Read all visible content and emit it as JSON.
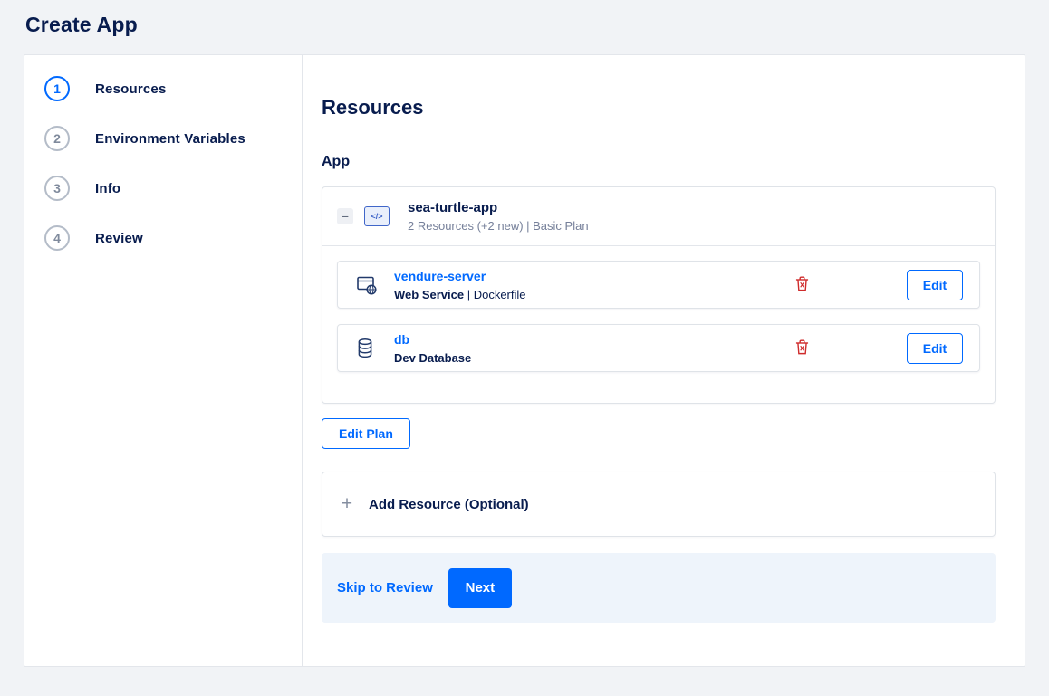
{
  "page": {
    "title": "Create App"
  },
  "steps": [
    {
      "number": "1",
      "label": "Resources",
      "active": true
    },
    {
      "number": "2",
      "label": "Environment Variables",
      "active": false
    },
    {
      "number": "3",
      "label": "Info",
      "active": false
    },
    {
      "number": "4",
      "label": "Review",
      "active": false
    }
  ],
  "content": {
    "heading": "Resources",
    "section_label": "App",
    "app": {
      "collapse_glyph": "−",
      "icon": "code-tag-icon",
      "icon_glyph": "</>",
      "name": "sea-turtle-app",
      "summary": "2 Resources (+2 new) | Basic Plan",
      "resources": [
        {
          "icon": "web-service-icon",
          "name": "vendure-server",
          "type": "Web Service",
          "sep": " | ",
          "detail": "Dockerfile",
          "delete_icon": "trash-icon",
          "edit_label": "Edit"
        },
        {
          "icon": "database-icon",
          "name": "db",
          "type": "Dev Database",
          "sep": "",
          "detail": "",
          "delete_icon": "trash-icon",
          "edit_label": "Edit"
        }
      ]
    },
    "edit_plan_label": "Edit Plan",
    "add_resource": {
      "icon": "plus-icon",
      "icon_glyph": "+",
      "label": "Add Resource (Optional)"
    },
    "footer": {
      "skip_label": "Skip to Review",
      "next_label": "Next"
    }
  },
  "colors": {
    "accent": "#0069ff",
    "danger": "#cf2b2b",
    "heading_text": "#081c4e",
    "muted_text": "#76809a",
    "footer_background": "#eef4fb",
    "page_background": "#f1f3f6"
  }
}
